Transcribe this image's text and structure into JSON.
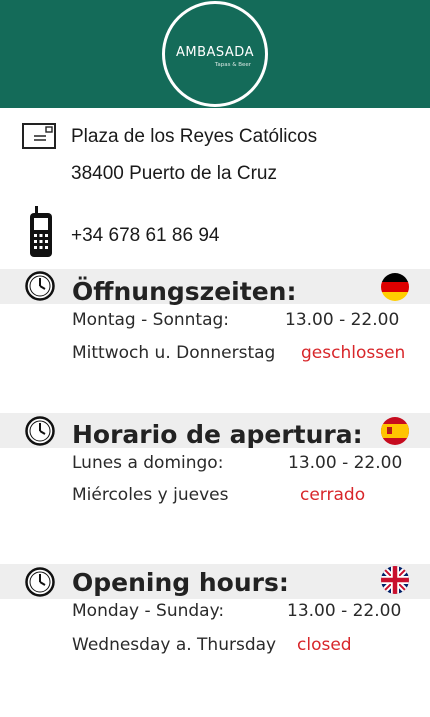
{
  "logo": {
    "name": "AMBASADA",
    "tagline": "Tapas & Beer"
  },
  "contact": {
    "address_line1": "Plaza de los Reyes Católicos",
    "address_line2": "38400 Puerto de la Cruz",
    "phone": "+34 678 61 86 94"
  },
  "colors": {
    "header": "#146b59",
    "closed": "#d8262a",
    "band": "#eeeeee"
  },
  "sections": [
    {
      "title": "Öffnungszeiten:",
      "flag": "germany-flag-icon",
      "row1_label": "Montag - Sonntag:",
      "row1_value": "13.00 - 22.00",
      "row2_label": "Mittwoch u. Donnerstag",
      "row2_value": "geschlossen"
    },
    {
      "title": "Horario de apertura:",
      "flag": "spain-flag-icon",
      "row1_label": "Lunes a domingo:",
      "row1_value": "13.00 - 22.00",
      "row2_label": "Miércoles y jueves",
      "row2_value": "cerrado"
    },
    {
      "title": "Opening hours:",
      "flag": "uk-flag-icon",
      "row1_label": "Monday - Sunday:",
      "row1_value": "13.00 - 22.00",
      "row2_label": "Wednesday a. Thursday",
      "row2_value": "closed"
    }
  ]
}
